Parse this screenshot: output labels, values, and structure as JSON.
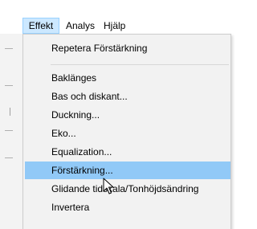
{
  "menubar": {
    "effekt": "Effekt",
    "analys": "Analys",
    "hjalp": "Hjälp"
  },
  "menu": {
    "repeat": "Repetera Förstärkning",
    "items": [
      "Baklänges",
      "Bas och diskant...",
      "Duckning...",
      "Eko...",
      "Equalization...",
      "Förstärkning...",
      "Glidande tidskala/Tonhöjdsändring",
      "Invertera"
    ],
    "highlighted": "Förstärkning..."
  },
  "colors": {
    "highlight": "#91c9f7",
    "menubar_active": "#cce8ff",
    "menu_background": "#f2f2f2"
  }
}
